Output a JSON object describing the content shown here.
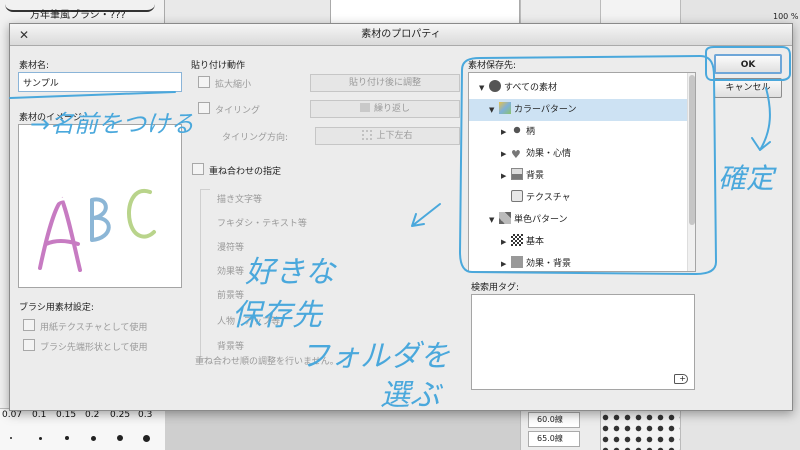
{
  "background": {
    "brush_name": "万年筆風ブラシ・???",
    "brush_sizes": [
      "0.07",
      "0.1",
      "0.15",
      "0.2",
      "0.25",
      "0.3"
    ],
    "line_sizes": [
      "60.0線",
      "65.0線"
    ],
    "layer_opacity": "100 %"
  },
  "dialog": {
    "title": "素材のプロパティ",
    "close_glyph": "✕",
    "material_name_label": "素材名:",
    "material_name_value": "サンプル",
    "material_image_label": "素材のイメージ:",
    "paste_section_label": "貼り付け動作",
    "scale_label": "拡大縮小",
    "scale_value": "貼り付け後に調整",
    "tiling_label": "タイリング",
    "tiling_value": "繰り返し",
    "tiling_direction_label": "タイリング方向:",
    "tiling_direction_value": "上下左右",
    "overlay_label": "重ね合わせの指定",
    "overlay_items": [
      "描き文字等",
      "フキダシ・テキスト等",
      "漫符等",
      "効果等",
      "前景等",
      "人物・アップ等",
      "背景等"
    ],
    "overlay_note": "重ね合わせ順の調整を行いません。",
    "brush_settings_label": "ブラシ用素材設定:",
    "paper_texture_label": "用紙テクスチャとして使用",
    "brush_tip_label": "ブラシ先端形状として使用",
    "storage_label": "素材保存先:",
    "tree": [
      {
        "label": "すべての素材",
        "icon": "globe-icon",
        "expanded": true,
        "selected": false
      },
      {
        "label": "カラーパターン",
        "icon": "color-pattern-icon",
        "expanded": true,
        "selected": true
      },
      {
        "label": "柄",
        "icon": "pattern-icon",
        "expanded": false,
        "selected": false
      },
      {
        "label": "効果・心情",
        "icon": "heart-icon",
        "expanded": false,
        "selected": false
      },
      {
        "label": "背景",
        "icon": "landscape-icon",
        "expanded": false,
        "selected": false
      },
      {
        "label": "テクスチャ",
        "icon": "texture-icon",
        "expanded": null,
        "selected": false
      },
      {
        "label": "単色パターン",
        "icon": "mono-pattern-icon",
        "expanded": true,
        "selected": false
      },
      {
        "label": "基本",
        "icon": "checker-icon",
        "expanded": false,
        "selected": false
      },
      {
        "label": "効果・背景",
        "icon": "effect-icon",
        "expanded": false,
        "selected": false
      }
    ],
    "search_tag_label": "検索用タグ:",
    "ok_label": "OK",
    "cancel_label": "キャンセル"
  },
  "handwriting": {
    "name_note": "→名前をつける",
    "folder_note_1": "好きな",
    "folder_note_2": "保存先",
    "folder_note_3": "フォルダを",
    "folder_note_4": "選ぶ",
    "confirm_note": "確定",
    "preview_letters": "ABC"
  },
  "colors": {
    "annotation": "#4aa8dc",
    "letter_a": "#c77bc2",
    "letter_b": "#8cb6d6",
    "letter_c": "#b9d48b",
    "selection": "#cde2f3"
  }
}
